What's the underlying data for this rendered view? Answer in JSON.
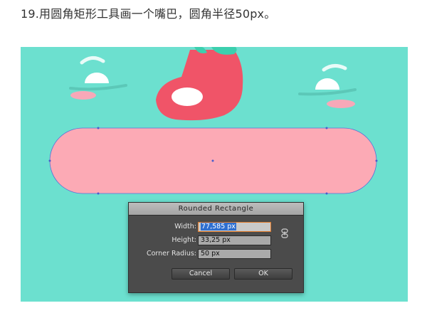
{
  "caption": "19.用圆角矩形工具画一个嘴巴，圆角半径50px。",
  "colors": {
    "background": "#6ce0cf",
    "mouth_fill": "#fcaab5",
    "tongue_fill": "#f05468",
    "dialog_bg": "#4b4b4b",
    "focus_border": "#e07a2a"
  },
  "dialog": {
    "title": "Rounded Rectangle",
    "fields": [
      {
        "label": "Width:",
        "value": "77,585 px"
      },
      {
        "label": "Height:",
        "value": "33,25 px"
      },
      {
        "label": "Corner Radius:",
        "value": "50 px"
      }
    ],
    "cancel_label": "Cancel",
    "ok_label": "OK",
    "link_icon": "link-constrain-icon"
  }
}
